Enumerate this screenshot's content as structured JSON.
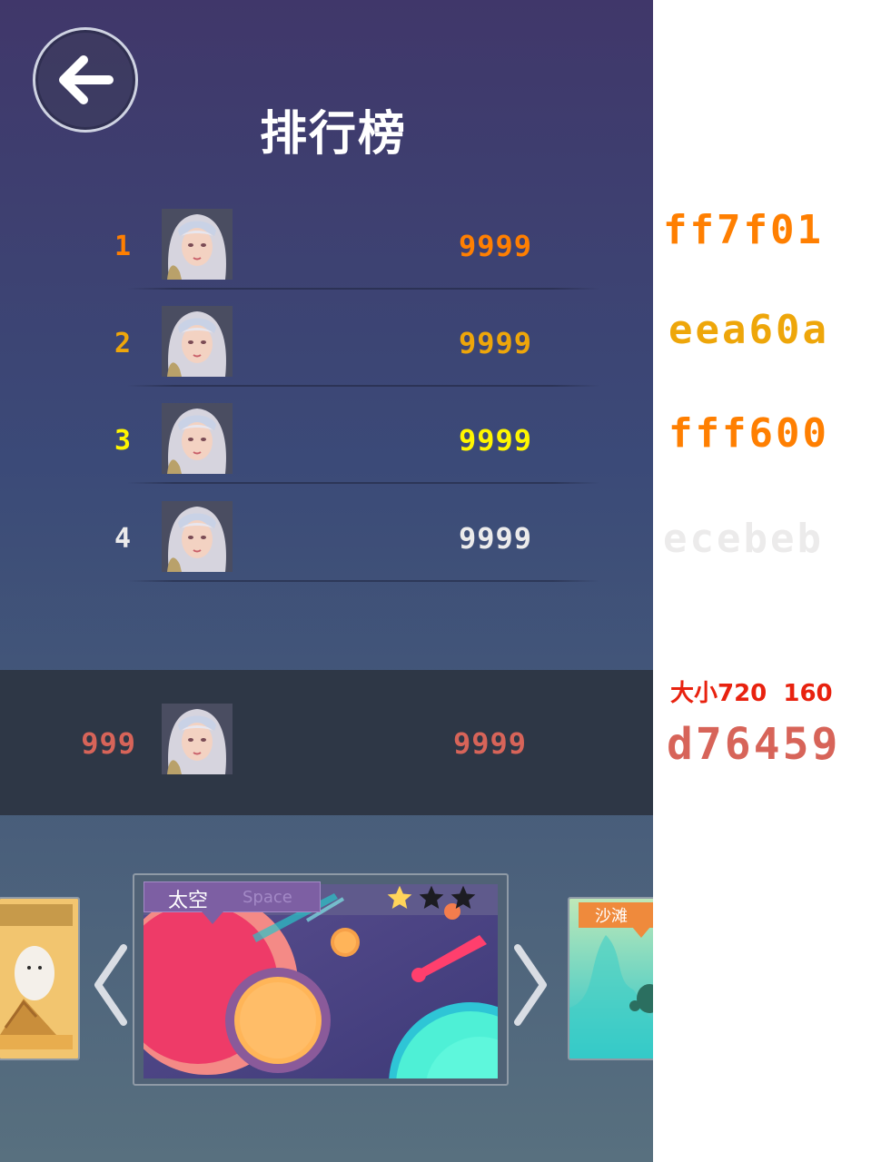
{
  "header": {
    "title": "排行榜"
  },
  "leaderboard": [
    {
      "rank": "1",
      "score": "9999",
      "color": "#ff7f01"
    },
    {
      "rank": "2",
      "score": "9999",
      "color": "#eea60a"
    },
    {
      "rank": "3",
      "score": "9999",
      "color": "#fff600"
    },
    {
      "rank": "4",
      "score": "9999",
      "color": "#ecebeb"
    }
  ],
  "my_rank": {
    "rank": "999",
    "score": "9999",
    "color": "#d76459"
  },
  "level_select": {
    "current": {
      "name_zh": "太空",
      "name_en": "Space",
      "stars_earned": 1,
      "stars_total": 3
    },
    "next": {
      "name_zh": "沙滩"
    }
  },
  "annotations": {
    "color_1": "ff7f01",
    "color_2": "eea60a",
    "color_3": "fff600",
    "color_4": "ecebeb",
    "size_note": "大小720  160",
    "color_5": "d76459"
  },
  "icons": [
    "back-arrow-icon",
    "chevron-left-icon",
    "chevron-right-icon",
    "star-icon"
  ]
}
